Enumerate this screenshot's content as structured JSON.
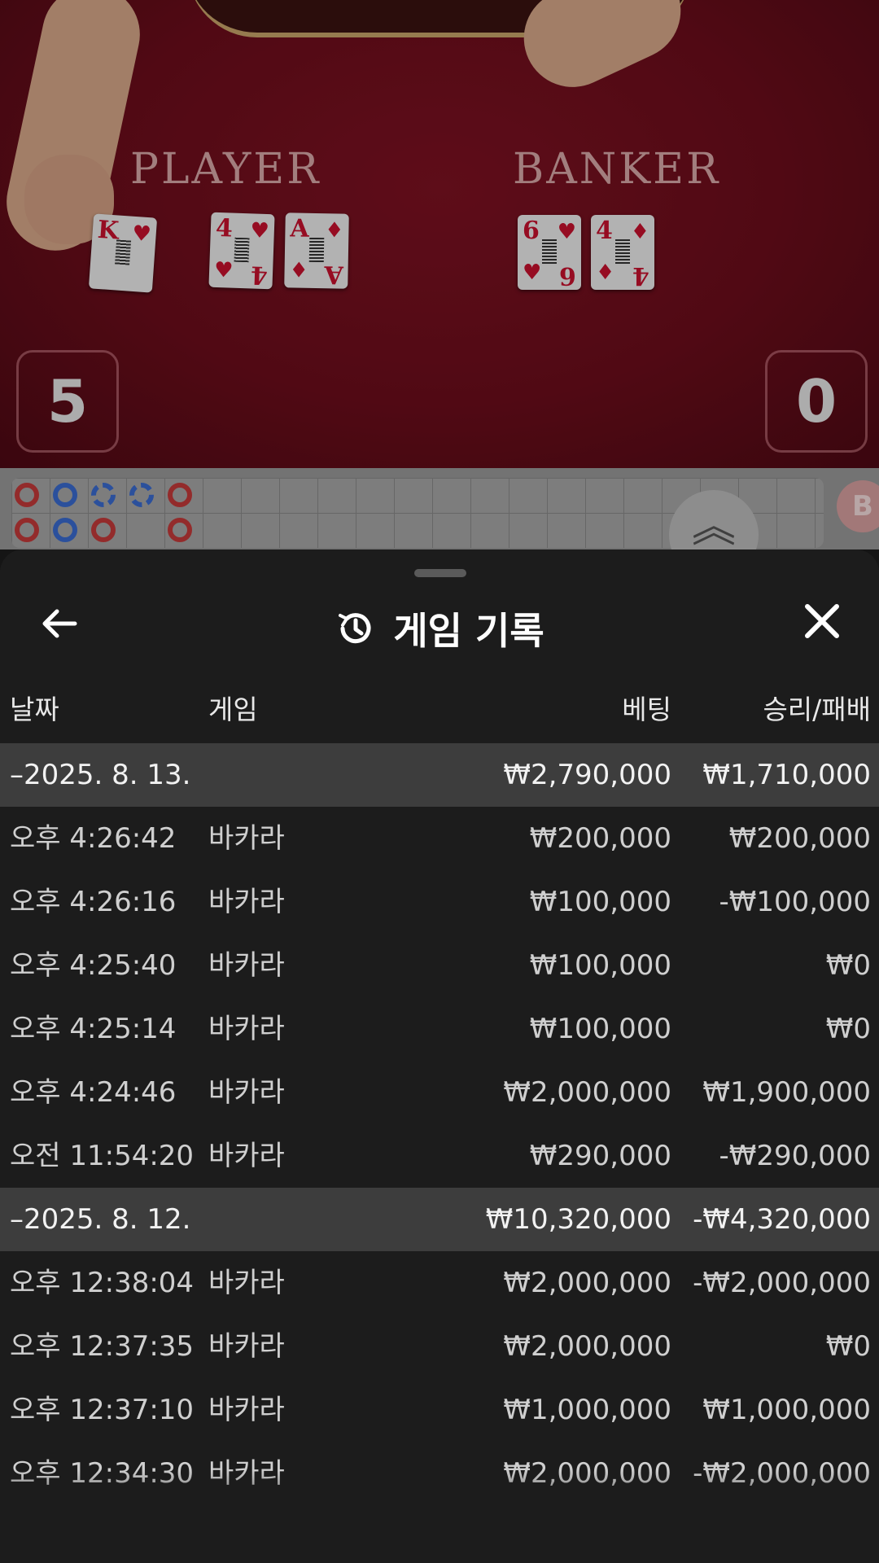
{
  "game_view": {
    "player_label": "PLAYER",
    "banker_label": "BANKER",
    "player_score": "5",
    "banker_score": "0",
    "player_cards": [
      {
        "rank": "K",
        "suit": "♥"
      },
      {
        "rank": "4",
        "suit": "♥"
      },
      {
        "rank": "A",
        "suit": "♦"
      }
    ],
    "banker_cards": [
      {
        "rank": "6",
        "suit": "♥"
      },
      {
        "rank": "4",
        "suit": "♦"
      }
    ],
    "side_badge": "B"
  },
  "sheet": {
    "title": "게임 기록",
    "back_icon": "arrow-left-icon",
    "history_icon": "history-icon",
    "close_icon": "close-icon",
    "columns": {
      "date": "날짜",
      "game": "게임",
      "bet": "베팅",
      "result": "승리/패배"
    },
    "groups": [
      {
        "date": "–2025. 8. 13.",
        "bet_total": "₩2,790,000",
        "result_total": "₩1,710,000",
        "rows": [
          {
            "time": "오후 4:26:42",
            "game": "바카라",
            "bet": "₩200,000",
            "result": "₩200,000"
          },
          {
            "time": "오후 4:26:16",
            "game": "바카라",
            "bet": "₩100,000",
            "result": "-₩100,000"
          },
          {
            "time": "오후 4:25:40",
            "game": "바카라",
            "bet": "₩100,000",
            "result": "₩0"
          },
          {
            "time": "오후 4:25:14",
            "game": "바카라",
            "bet": "₩100,000",
            "result": "₩0"
          },
          {
            "time": "오후 4:24:46",
            "game": "바카라",
            "bet": "₩2,000,000",
            "result": "₩1,900,000"
          },
          {
            "time": "오전 11:54:20",
            "game": "바카라",
            "bet": "₩290,000",
            "result": "-₩290,000"
          }
        ]
      },
      {
        "date": "–2025. 8. 12.",
        "bet_total": "₩10,320,000",
        "result_total": "-₩4,320,000",
        "rows": [
          {
            "time": "오후 12:38:04",
            "game": "바카라",
            "bet": "₩2,000,000",
            "result": "-₩2,000,000"
          },
          {
            "time": "오후 12:37:35",
            "game": "바카라",
            "bet": "₩2,000,000",
            "result": "₩0"
          },
          {
            "time": "오후 12:37:10",
            "game": "바카라",
            "bet": "₩1,000,000",
            "result": "₩1,000,000"
          },
          {
            "time": "오후 12:34:30",
            "game": "바카라",
            "bet": "₩2,000,000",
            "result": "-₩2,000,000"
          }
        ]
      }
    ]
  },
  "colors": {
    "felt": "#6c0d1b",
    "sheet_bg": "#1c1c1c",
    "group_bg": "#3d3d3d",
    "bead_red": "#c43a3a",
    "bead_blue": "#3a6bd1"
  }
}
